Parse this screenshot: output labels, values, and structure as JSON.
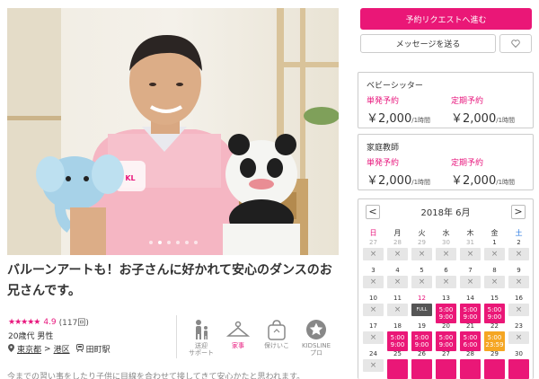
{
  "photo": {
    "alt": "sitter-photo",
    "slides": 6,
    "active_slide": 1
  },
  "headline": "バルーンアートも！お子さんに好かれて安心のダンスのお兄さんです。",
  "profile": {
    "stars": "★★★★★",
    "rating": "4.9",
    "review_count": "(117回)",
    "age_gender": "20歳代 男性",
    "pref": "東京都",
    "sep": ">",
    "ward": "港区",
    "station": "田町駅"
  },
  "features": [
    {
      "label": "送迎\nサポート",
      "icon": "pickup-support-icon",
      "active": false
    },
    {
      "label": "家事",
      "icon": "hanger-icon",
      "active": true
    },
    {
      "label": "保けいこ",
      "icon": "bag-icon",
      "active": false
    },
    {
      "label": "KIDSLINE\nプロ",
      "icon": "star-badge-icon",
      "active": false
    }
  ],
  "faded_text": "今までの習い事をしたり子供に目線を合わせて接してきて安心かたと思われます。",
  "actions": {
    "request_label": "予約リクエストへ進む",
    "message_label": "メッセージを送る",
    "favorite_icon": "heart-icon"
  },
  "pricing": [
    {
      "title": "ベビーシッター",
      "single_label": "単発予約",
      "single_price": "￥2,000",
      "single_unit": "/1時間",
      "regular_label": "定期予約",
      "regular_price": "￥2,000",
      "regular_unit": "/1時間"
    },
    {
      "title": "家庭教師",
      "single_label": "単発予約",
      "single_price": "￥2,000",
      "single_unit": "/1時間",
      "regular_label": "定期予約",
      "regular_price": "￥2,000",
      "regular_unit": "/1時間"
    }
  ],
  "calendar": {
    "title": "2018年 6月",
    "prev": "<",
    "next": ">",
    "dow": [
      "日",
      "月",
      "火",
      "水",
      "木",
      "金",
      "土"
    ],
    "dow_colors": [
      "#e8177d",
      "#333333",
      "#333333",
      "#333333",
      "#333333",
      "#333333",
      "#2a7ae2"
    ],
    "weeks": [
      [
        {
          "d": "27",
          "s": "x",
          "m": 0
        },
        {
          "d": "28",
          "s": "x",
          "m": 0
        },
        {
          "d": "29",
          "s": "x",
          "m": 0
        },
        {
          "d": "30",
          "s": "x",
          "m": 0
        },
        {
          "d": "31",
          "s": "x",
          "m": 0
        },
        {
          "d": "1",
          "s": "x",
          "m": 1
        },
        {
          "d": "2",
          "s": "x",
          "m": 1
        }
      ],
      [
        {
          "d": "3",
          "s": "x",
          "m": 1
        },
        {
          "d": "4",
          "s": "x",
          "m": 1
        },
        {
          "d": "5",
          "s": "x",
          "m": 1
        },
        {
          "d": "6",
          "s": "x",
          "m": 1
        },
        {
          "d": "7",
          "s": "x",
          "m": 1
        },
        {
          "d": "8",
          "s": "x",
          "m": 1
        },
        {
          "d": "9",
          "s": "x",
          "m": 1
        }
      ],
      [
        {
          "d": "10",
          "s": "x",
          "m": 1
        },
        {
          "d": "11",
          "s": "x",
          "m": 1
        },
        {
          "d": "12",
          "s": "full",
          "m": 1
        },
        {
          "d": "13",
          "s": "avail",
          "t1": "5:00",
          "t2": "9:00",
          "m": 1
        },
        {
          "d": "14",
          "s": "avail",
          "t1": "5:00",
          "t2": "9:00",
          "m": 1
        },
        {
          "d": "15",
          "s": "avail",
          "t1": "5:00",
          "t2": "9:00",
          "m": 1
        },
        {
          "d": "16",
          "s": "x",
          "m": 1
        }
      ],
      [
        {
          "d": "17",
          "s": "x",
          "m": 1
        },
        {
          "d": "18",
          "s": "avail",
          "t1": "5:00",
          "t2": "9:00",
          "m": 1
        },
        {
          "d": "19",
          "s": "avail",
          "t1": "5:00",
          "t2": "9:00",
          "m": 1
        },
        {
          "d": "20",
          "s": "avail",
          "t1": "5:00",
          "t2": "9:00",
          "m": 1
        },
        {
          "d": "21",
          "s": "avail",
          "t1": "5:00",
          "t2": "6:00",
          "m": 1
        },
        {
          "d": "22",
          "s": "half",
          "t1": "5:00",
          "t2": "23:59",
          "m": 1
        },
        {
          "d": "23",
          "s": "x",
          "m": 1
        }
      ],
      [
        {
          "d": "24",
          "s": "x",
          "m": 1
        },
        {
          "d": "25",
          "s": "avail",
          "t1": "",
          "t2": "",
          "m": 1
        },
        {
          "d": "26",
          "s": "avail",
          "t1": "",
          "t2": "",
          "m": 1
        },
        {
          "d": "27",
          "s": "avail",
          "t1": "",
          "t2": "",
          "m": 1
        },
        {
          "d": "28",
          "s": "avail",
          "t1": "",
          "t2": "",
          "m": 1
        },
        {
          "d": "29",
          "s": "avail",
          "t1": "",
          "t2": "",
          "m": 1
        },
        {
          "d": "30",
          "s": "avail",
          "t1": "",
          "t2": "",
          "m": 1
        }
      ]
    ],
    "full_badge": "FULL",
    "x_mark": "×"
  }
}
